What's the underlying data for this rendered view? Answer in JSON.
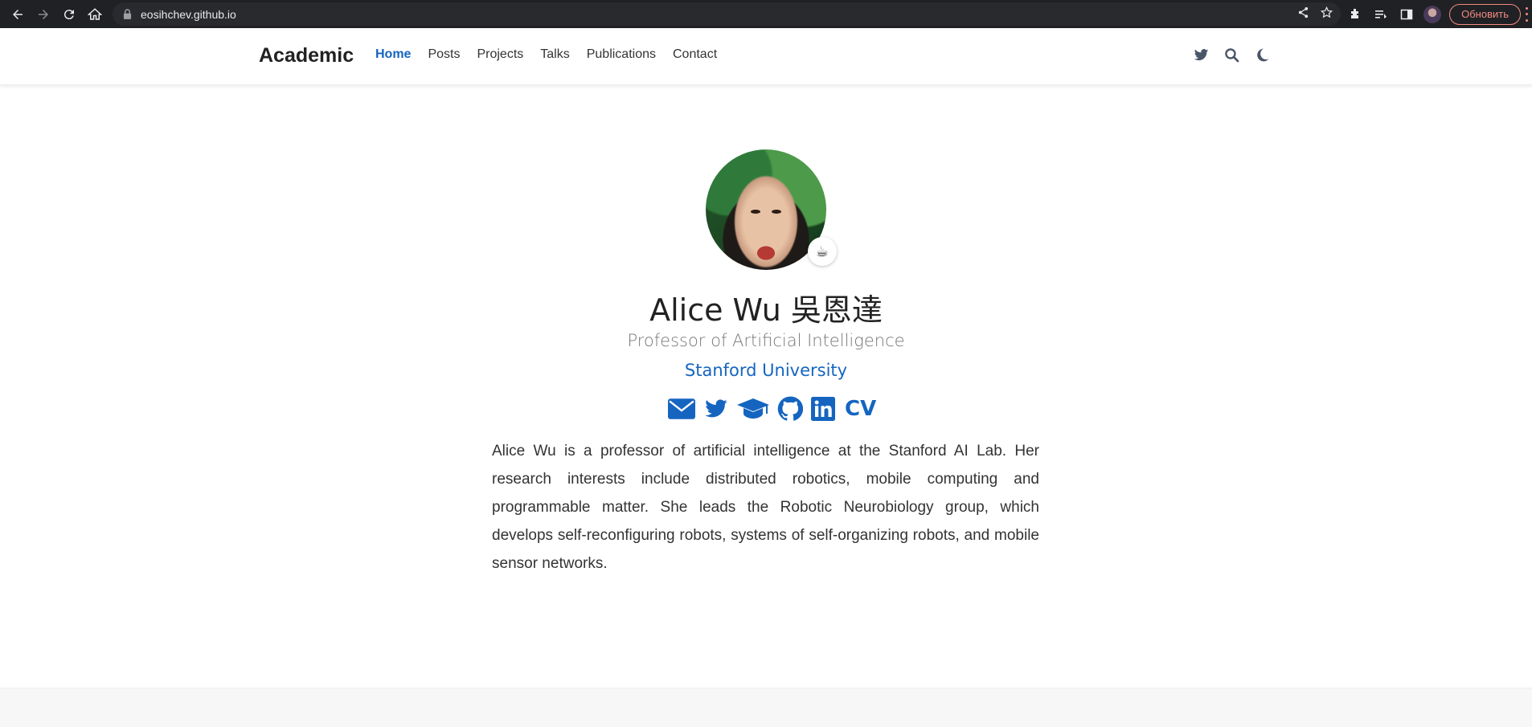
{
  "browser": {
    "url": "eosihchev.github.io",
    "update_label": "Обновить"
  },
  "site": {
    "brand": "Academic",
    "menu": [
      {
        "label": "Home",
        "active": true
      },
      {
        "label": "Posts"
      },
      {
        "label": "Projects"
      },
      {
        "label": "Talks"
      },
      {
        "label": "Publications"
      },
      {
        "label": "Contact"
      }
    ],
    "nav_icons": [
      "twitter-icon",
      "search-icon",
      "moon-icon"
    ]
  },
  "profile": {
    "status_emoji": "☕",
    "name": "Alice Wu 吳恩達",
    "role": "Professor of Artificial Intelligence",
    "organization": "Stanford University",
    "social": [
      "envelope-icon",
      "twitter-icon",
      "graduation-cap-icon",
      "github-icon",
      "linkedin-icon"
    ],
    "cv_label": "CV",
    "bio": "Alice Wu is a professor of artificial intelligence at the Stanford AI Lab. Her research interests include distributed robotics, mobile computing and programmable matter. She leads the Robotic Neurobiology group, which develops self-reconfiguring robots, systems of self-organizing robots, and mobile sensor networks."
  },
  "colors": {
    "accent": "#1565c0",
    "chrome_bg": "#202124"
  }
}
